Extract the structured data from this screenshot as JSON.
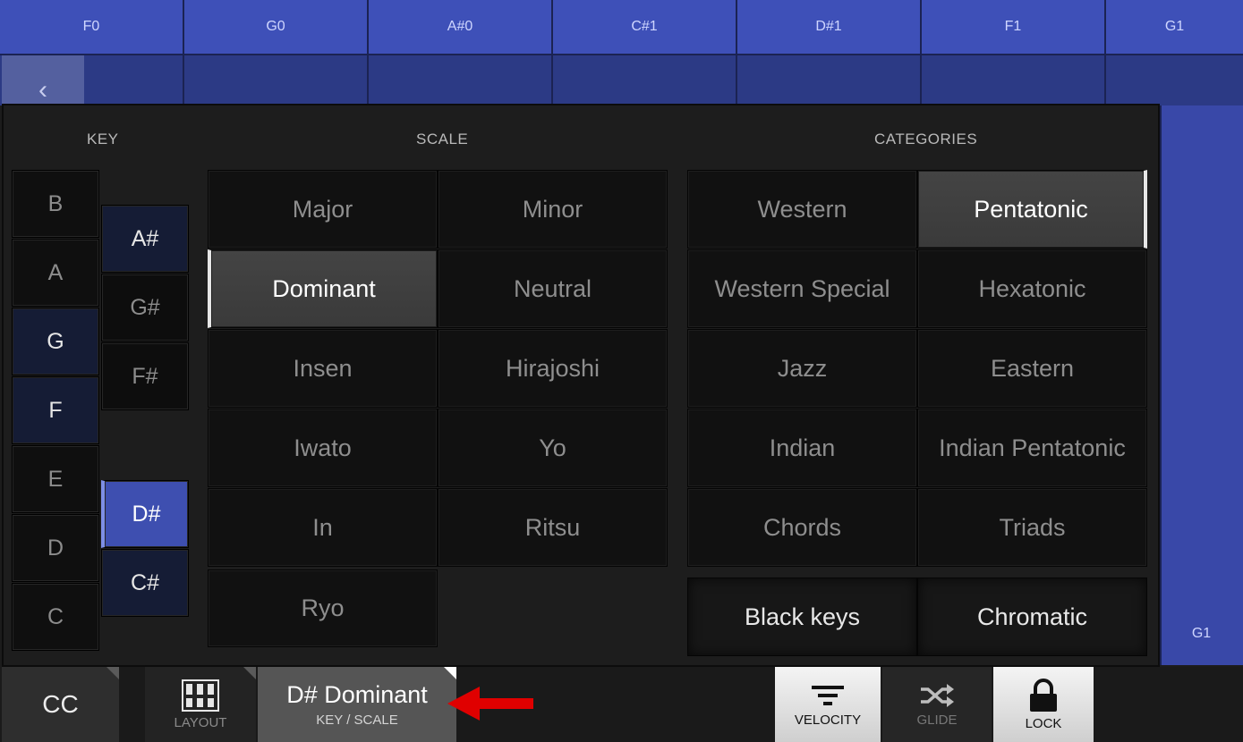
{
  "top_notes": [
    "F0",
    "G0",
    "A#0",
    "C#1",
    "D#1",
    "F1",
    "G1"
  ],
  "right_column_note": "G1",
  "back_icon": "‹",
  "headers": {
    "key": "KEY",
    "scale": "SCALE",
    "categories": "CATEGORIES"
  },
  "keys": {
    "white": [
      "B",
      "A",
      "G",
      "F",
      "E",
      "D",
      "C"
    ],
    "black": [
      "A#",
      "G#",
      "F#",
      "D#",
      "C#"
    ]
  },
  "scales": [
    "Major",
    "Minor",
    "Dominant",
    "Neutral",
    "Insen",
    "Hirajoshi",
    "Iwato",
    "Yo",
    "In",
    "Ritsu",
    "Ryo"
  ],
  "categories": [
    "Western",
    "Pentatonic",
    "Western Special",
    "Hexatonic",
    "Jazz",
    "Eastern",
    "Indian",
    "Indian Pentatonic",
    "Chords",
    "Triads"
  ],
  "extra_buttons": {
    "black_keys": "Black keys",
    "chromatic": "Chromatic"
  },
  "selected": {
    "key": "D#",
    "scale": "Dominant",
    "category": "Pentatonic"
  },
  "bottom": {
    "cc": "CC",
    "layout": "LAYOUT",
    "key_scale_value": "D# Dominant",
    "key_scale_label": "KEY / SCALE",
    "velocity": "VELOCITY",
    "glide": "GLIDE",
    "lock": "LOCK"
  },
  "colors": {
    "accent_blue": "#3e50b8",
    "arrow_red": "#e00000"
  },
  "icons": [
    "chevron-left-icon",
    "layout-grid-icon",
    "filter-icon",
    "shuffle-icon",
    "lock-icon",
    "red-arrow-icon"
  ]
}
